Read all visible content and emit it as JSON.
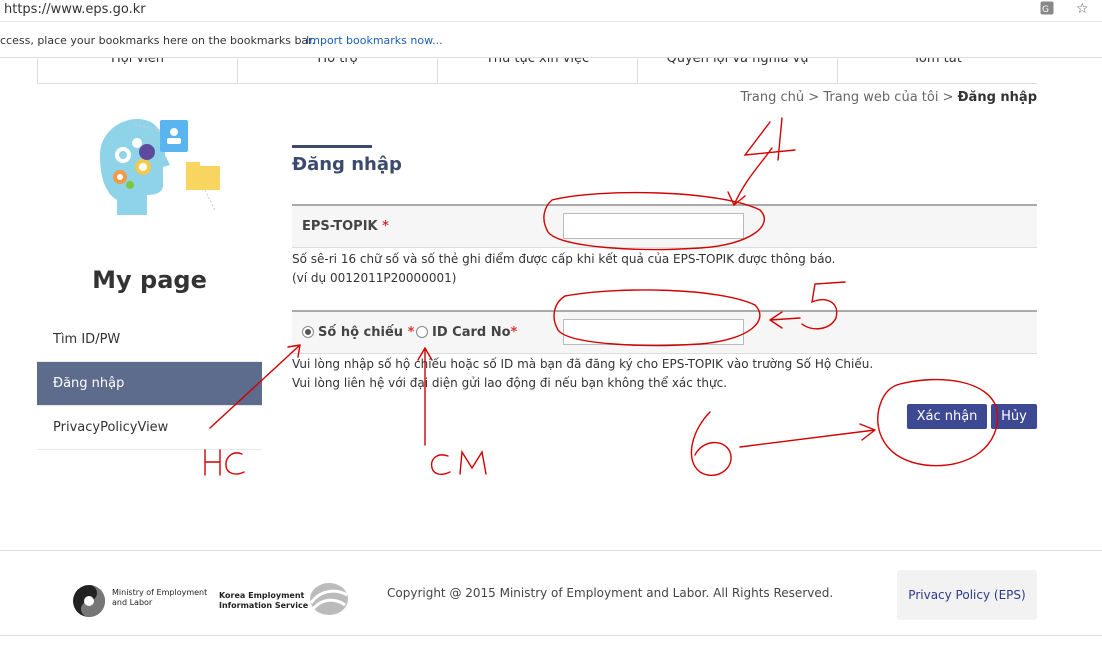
{
  "browser": {
    "url": "https://www.eps.go.kr",
    "bookmarks_text": "ccess, place your bookmarks here on the bookmarks bar.",
    "bookmarks_link": "Import bookmarks now..."
  },
  "nav": {
    "items": [
      "Hội viên",
      "Hỗ trợ",
      "Thủ tục xin việc",
      "Quyền lợi và nghĩa vụ",
      "Tóm tắt"
    ]
  },
  "breadcrumb": {
    "home": "Trang chủ",
    "sep": ">",
    "mypage": "Trang web của tôi",
    "current": "Đăng nhập"
  },
  "sidebar": {
    "title": "My page",
    "items": [
      {
        "label": "Tìm ID/PW",
        "active": false
      },
      {
        "label": "Đăng nhập",
        "active": true
      },
      {
        "label": "PrivacyPolicyView",
        "active": false
      }
    ]
  },
  "main": {
    "title": "Đăng nhập",
    "eps_label": "EPS-TOPIK",
    "required_mark": "*",
    "eps_value": "",
    "eps_help_1": "Số sê-ri 16 chữ số và số thẻ ghi điểm được cấp khi kết quả của EPS-TOPIK được thông báo.",
    "eps_help_2": "(ví dụ 0012011P20000001)",
    "passport_label": "Số hộ chiếu",
    "idcard_label": "ID Card No",
    "passport_value": "",
    "id_help_1": "Vui lòng nhập số hộ chiếu hoặc số ID mà bạn đã đăng ký cho EPS-TOPIK vào trường Số Hộ Chiếu.",
    "id_help_2": "Vui lòng liên hệ với đại diện gửi lao động đi nếu bạn không thể xác thực.",
    "confirm_label": "Xác nhận",
    "cancel_label": "Hủy"
  },
  "footer": {
    "ministry": "Ministry of Employment and Labor",
    "keis_1": "Korea Employment",
    "keis_2": "Information Service",
    "copyright": "Copyright @ 2015 Ministry of Employment and Labor. All Rights Reserved.",
    "privacy": "Privacy Policy (EPS)"
  },
  "annotations": {
    "n4": "4",
    "n5": "5",
    "n6": "6",
    "hc": "HC",
    "cm": "CM"
  },
  "colors": {
    "accent": "#3d4a93",
    "sidebar_active": "#5d6b8c",
    "annotation": "#d40000"
  }
}
